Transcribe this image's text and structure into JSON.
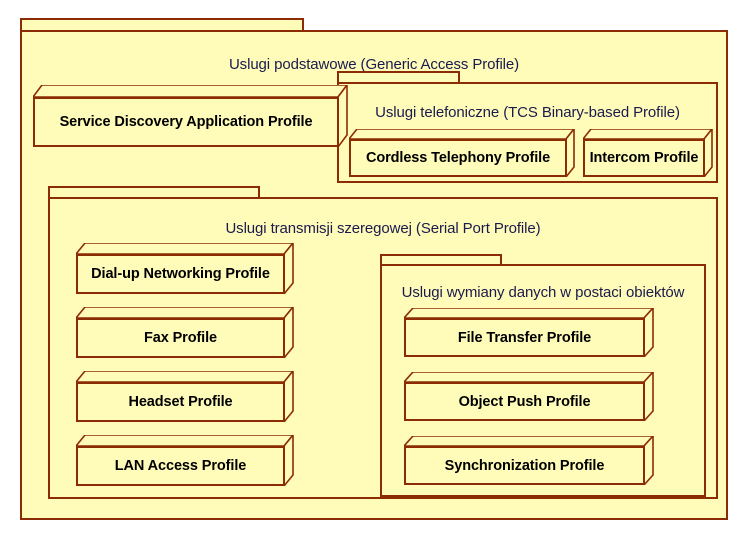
{
  "diagram": {
    "type": "uml-package-diagram",
    "title": "Bluetooth profiles package diagram",
    "colors": {
      "package_fill": "#FFFCB9",
      "border": "#8C2C04",
      "package_label_text": "#1A1A4E",
      "component_label_text": "#000000",
      "canvas": "#FFFFFF"
    }
  },
  "packages": {
    "generic_access": {
      "label": "Uslugi podstawowe (Generic Access Profile)",
      "components": [
        {
          "label": "Service Discovery Application Profile"
        }
      ]
    },
    "telephony": {
      "label": "Uslugi telefoniczne (TCS Binary-based Profile)",
      "components": [
        {
          "label": "Cordless Telephony Profile"
        },
        {
          "label": "Intercom Profile"
        }
      ]
    },
    "serial_port": {
      "label": "Uslugi transmisji szeregowej (Serial Port Profile)",
      "components": [
        {
          "label": "Dial-up Networking Profile"
        },
        {
          "label": "Fax Profile"
        },
        {
          "label": "Headset Profile"
        },
        {
          "label": "LAN Access Profile"
        }
      ]
    },
    "object_exchange": {
      "label": "Uslugi wymiany danych w postaci obiektów",
      "components": [
        {
          "label": "File Transfer Profile"
        },
        {
          "label": "Object Push Profile"
        },
        {
          "label": "Synchronization Profile"
        }
      ]
    }
  }
}
